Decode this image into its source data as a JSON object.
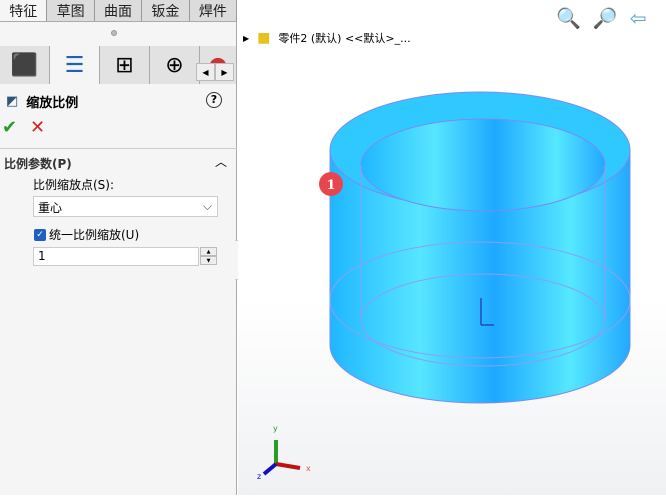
{
  "tabs": [
    "特征",
    "草图",
    "曲面",
    "钣金",
    "焊件"
  ],
  "manager_tabs": [
    "feature-manager",
    "property-manager",
    "configuration-manager",
    "dimxpert-manager",
    "appearance"
  ],
  "feature": {
    "title": "缩放比例",
    "help": "?",
    "ok": "✔",
    "cancel": "✕"
  },
  "section": {
    "title": "比例参数(P)",
    "scale_point_label": "比例缩放点(S):",
    "scale_point_value": "重心",
    "uniform_label": "统一比例缩放(U)",
    "uniform_checked": true,
    "scale_value": "1"
  },
  "tree": {
    "item": "零件2 (默认) <<默认>_..."
  },
  "callout": "1",
  "triad": {
    "x": "x",
    "y": "y",
    "z": "z"
  },
  "colors": {
    "part": "#29c8ff",
    "accent": "#1f5fbf",
    "callout": "#e8464f"
  }
}
